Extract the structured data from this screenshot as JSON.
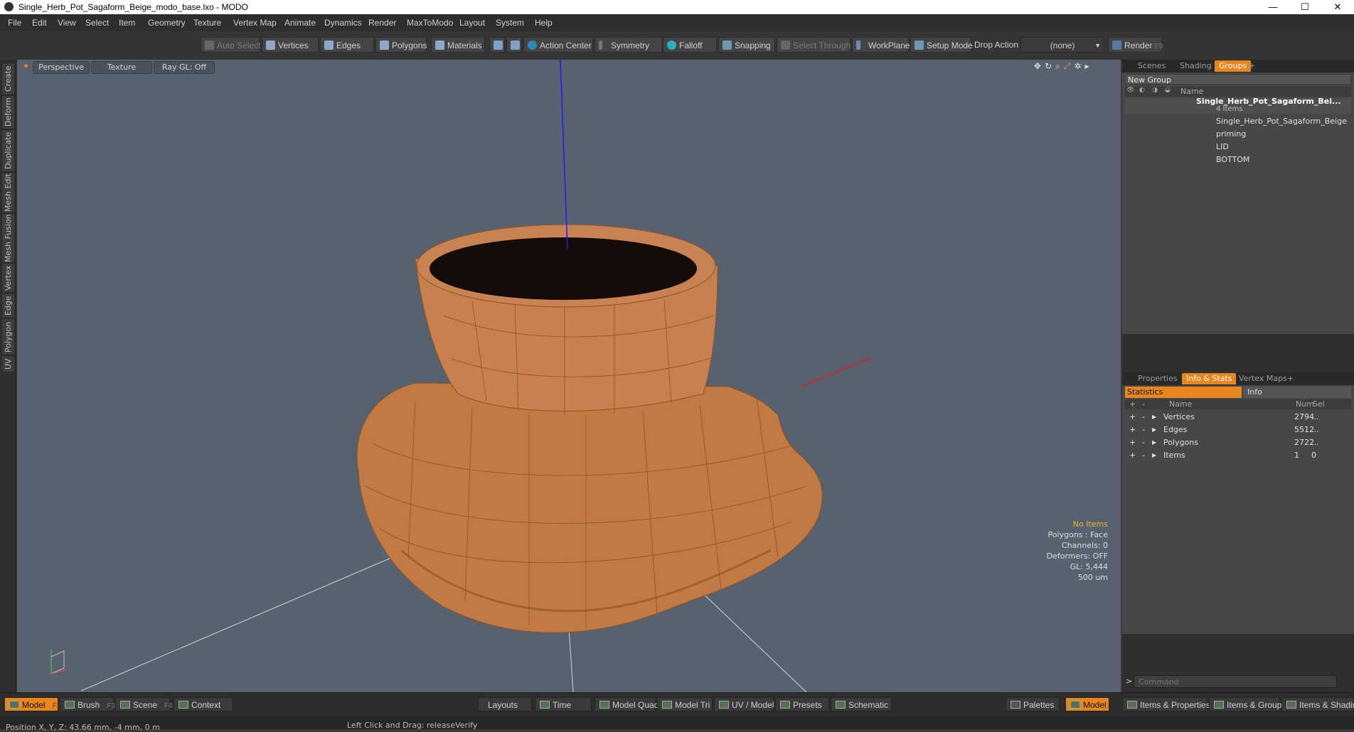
{
  "window": {
    "title": "Single_Herb_Pot_Sagaform_Beige_modo_base.lxo - MODO",
    "minimize": "—",
    "maximize": "☐",
    "close": "✕"
  },
  "menu": [
    "File",
    "Edit",
    "View",
    "Select",
    "Item",
    "Geometry",
    "Texture",
    "Vertex Map",
    "Animate",
    "Dynamics",
    "Render",
    "MaxToModo",
    "Layout",
    "System",
    "Help"
  ],
  "toolbar": {
    "auto_select": "Auto Select",
    "vertices": "Vertices",
    "edges": "Edges",
    "polygons": "Polygons",
    "materials": "Materials",
    "action_center": "Action Center",
    "symmetry": "Symmetry",
    "falloff": "Falloff",
    "snapping": "Snapping",
    "select_through": "Select Through",
    "workplane": "WorkPlane",
    "setup_mode": "Setup Mode",
    "drop_action_label": "Drop Action",
    "drop_action_value": "(none)",
    "render": "Render",
    "render_key": "F9"
  },
  "left_tabs": [
    "Create",
    "Deform",
    "Duplicate",
    "Mesh Edit",
    "Mesh Fusion",
    "Vertex",
    "Edge",
    "Polygon",
    "UV"
  ],
  "viewport": {
    "view": "Perspective",
    "shading": "Texture",
    "raygl": "Ray GL: Off",
    "stats": {
      "selection": "No Items",
      "polygons": "Polygons : Face",
      "channels": "Channels: 0",
      "deformers": "Deformers: OFF",
      "gl": "GL: 5,444",
      "scale": "500 um"
    }
  },
  "scene_panel": {
    "tabs": [
      "Scenes",
      "Shading",
      "Groups"
    ],
    "active_tab": "Groups",
    "new_group": "New Group",
    "name_header": "Name",
    "group": {
      "name": "Single_Herb_Pot_Sagaform_Bei...",
      "count": "4 Items"
    },
    "items": [
      "Single_Herb_Pot_Sagaform_Beige",
      "priming",
      "LID",
      "BOTTOM"
    ]
  },
  "info_panel": {
    "tabs": [
      "Properties",
      "Info & Stats",
      "Vertex Maps"
    ],
    "active_tab": "Info & Stats",
    "subtabs": [
      "Statistics",
      "Info"
    ],
    "headers": {
      "name": "Name",
      "num": "Num",
      "sel": "Sel"
    },
    "rows": [
      {
        "name": "Vertices",
        "num": "2794",
        "sel": "..."
      },
      {
        "name": "Edges",
        "num": "5512",
        "sel": "..."
      },
      {
        "name": "Polygons",
        "num": "2722",
        "sel": "..."
      },
      {
        "name": "Items",
        "num": "1",
        "sel": "0"
      }
    ],
    "command_placeholder": "Command"
  },
  "bottom": {
    "model": "Model",
    "model_key": "F2",
    "brush": "Brush",
    "brush_key": "F3",
    "scene": "Scene",
    "scene_key": "F4",
    "context": "Context",
    "layouts": "Layouts",
    "time": "Time",
    "model_quad": "Model Quad",
    "model_tri": "Model Tri",
    "uv_model": "UV / Model",
    "presets": "Presets",
    "schematic": "Schematic",
    "palettes": "Palettes",
    "model_right": "Model",
    "items_properties": "Items & Properties",
    "items_groups": "Items & Groups",
    "items_shading": "Items & Shading"
  },
  "statusbar": {
    "position": "Position X, Y, Z:   43.66 mm, -4 mm, 0 m",
    "hint": "Left Click and Drag:  releaseVerify"
  }
}
